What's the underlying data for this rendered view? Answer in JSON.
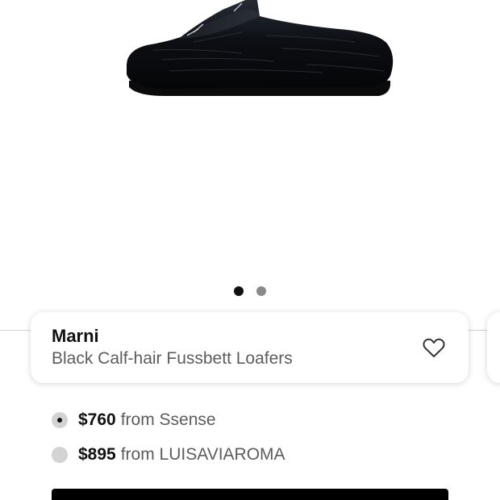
{
  "product": {
    "image_icon": "calf-hair-slipper-photo",
    "brand": "Marni",
    "name": "Black Calf-hair Fussbett Loafers",
    "favorite_icon": "heart-outline-icon"
  },
  "carousel": {
    "image_count": 2,
    "active_index": 0
  },
  "offers": [
    {
      "price": "$760",
      "from_text": "from Ssense",
      "selected": true
    },
    {
      "price": "$895",
      "from_text": "from LUISAVIAROMA",
      "selected": false
    }
  ],
  "buy_button": {
    "label": ""
  },
  "colors": {
    "text_primary": "#111111",
    "text_secondary": "#5c5c5c",
    "radio_unselected": "#d3d3d3",
    "button_bg": "#000000"
  }
}
